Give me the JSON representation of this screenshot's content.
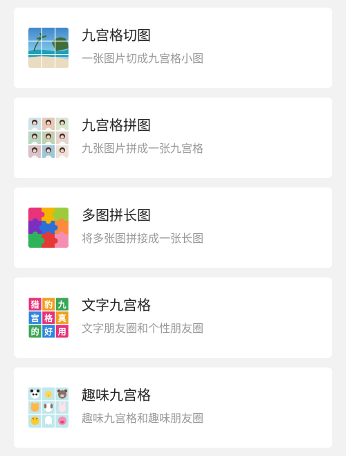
{
  "tools": [
    {
      "title": "九宫格切图",
      "subtitle": "一张图片切成九宫格小图",
      "icon": "beach-photo-grid-icon"
    },
    {
      "title": "九宫格拼图",
      "subtitle": "九张图片拼成一张九宫格",
      "icon": "portrait-collage-icon"
    },
    {
      "title": "多图拼长图",
      "subtitle": "将多张图拼接成一张长图",
      "icon": "puzzle-pieces-icon"
    },
    {
      "title": "文字九宫格",
      "subtitle": "文字朋友圈和个性朋友圈",
      "icon": "text-grid-icon"
    },
    {
      "title": "趣味九宫格",
      "subtitle": "趣味九宫格和趣味朋友圈",
      "icon": "animal-faces-grid-icon"
    }
  ],
  "text_grid_chars": [
    "猎",
    "豹",
    "九",
    "宫",
    "格",
    "真",
    "的",
    "好",
    "用"
  ],
  "colors": {
    "background": "#f2f2f2",
    "card": "#ffffff",
    "title": "#222222",
    "subtitle": "#9a9a9a",
    "text_grid_cells": [
      "#e8327a",
      "#f0a01e",
      "#3aa757",
      "#2e86de",
      "#e8327a",
      "#f0a01e",
      "#3aa757",
      "#2e86de",
      "#e8327a"
    ]
  }
}
